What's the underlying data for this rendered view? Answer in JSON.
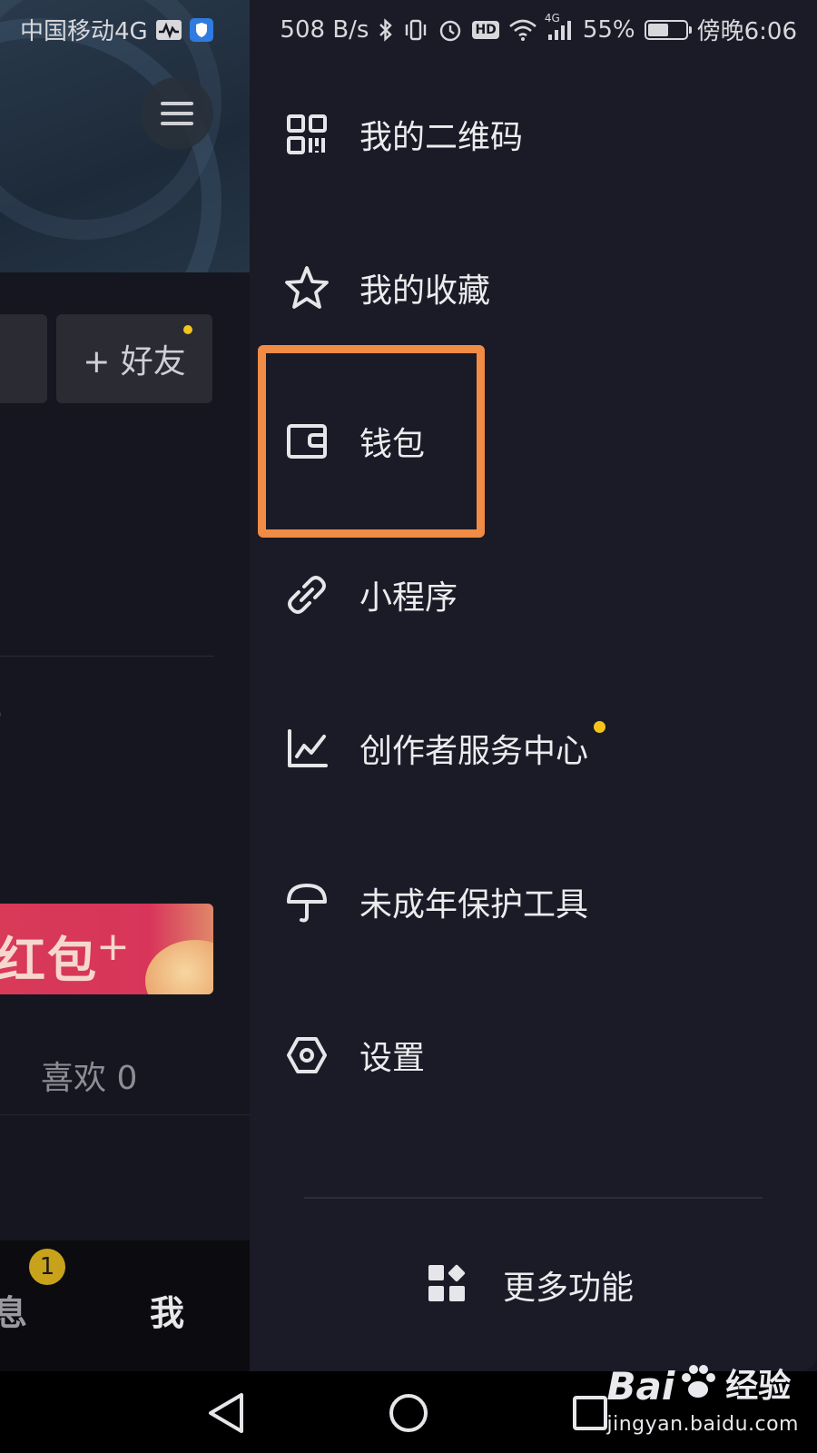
{
  "status_bar": {
    "carrier": "中国移动4G",
    "net_speed": "508 B/s",
    "network_type": "4G",
    "battery_percent": "55%",
    "battery_level": 0.55,
    "time": "傍晚6:06",
    "hd_label": "HD"
  },
  "background_page": {
    "add_friend_label": "+ 好友",
    "red_packet_text": "红包",
    "red_packet_spark": "+",
    "likes_label": "喜欢 0",
    "bottom_nav": {
      "messages_label": "息",
      "messages_badge": "1",
      "me_label": "我"
    }
  },
  "drawer": {
    "items": [
      {
        "label": "我的二维码",
        "icon": "qr-code-icon"
      },
      {
        "label": "我的收藏",
        "icon": "star-icon"
      },
      {
        "label": "钱包",
        "icon": "wallet-icon"
      },
      {
        "label": "小程序",
        "icon": "link-icon"
      },
      {
        "label": "创作者服务中心",
        "icon": "chart-icon"
      },
      {
        "label": "未成年保护工具",
        "icon": "umbrella-icon"
      },
      {
        "label": "设置",
        "icon": "settings-icon"
      }
    ],
    "more_label": "更多功能",
    "highlighted_item": "钱包"
  },
  "watermark": {
    "brand": "Bai",
    "brand_cn": "经验",
    "url": "jingyan.baidu.com"
  },
  "colors": {
    "drawer_bg": "#1a1b26",
    "highlight": "#f08c45",
    "dot": "#f4c41a",
    "red_packet": "#d8355a"
  }
}
